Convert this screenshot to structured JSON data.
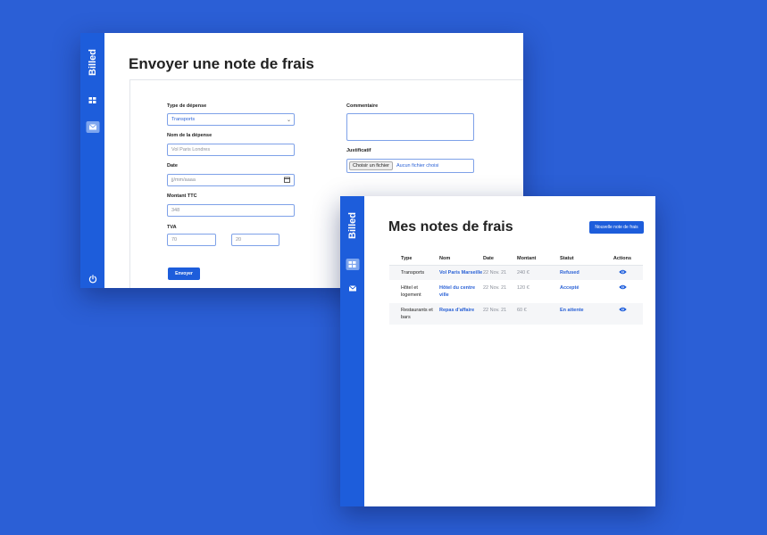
{
  "brand": "Billed",
  "colors": {
    "background": "#2b5fd6",
    "accent": "#1d5ddb",
    "link": "#2b62d6"
  },
  "form_window": {
    "title": "Envoyer une note de frais",
    "fields": {
      "type_label": "Type de dépense",
      "type_value": "Transports",
      "nom_label": "Nom de la dépense",
      "nom_placeholder": "Vol Paris Londres",
      "date_label": "Date",
      "date_placeholder": "jj/mm/aaaa",
      "montant_label": "Montant TTC",
      "montant_placeholder": "348",
      "tva_label": "TVA",
      "tva_amount_placeholder": "70",
      "tva_pct_placeholder": "20",
      "commentaire_label": "Commentaire",
      "justificatif_label": "Justificatif",
      "file_button": "Choisir un fichier",
      "file_status": "Aucun fichier choisi"
    },
    "submit_label": "Envoyer",
    "icons": [
      "window-icon",
      "mail-icon",
      "power-icon"
    ]
  },
  "list_window": {
    "title": "Mes notes de frais",
    "new_button": "Nouvelle note de frais",
    "columns": [
      "Type",
      "Nom",
      "Date",
      "Montant",
      "Statut",
      "Actions"
    ],
    "rows": [
      {
        "type": "Transports",
        "nom": "Vol Paris Marseille",
        "date": "22 Nov. 21",
        "montant": "240 €",
        "statut": "Refused"
      },
      {
        "type": "Hôtel et logement",
        "nom": "Hôtel du centre ville",
        "date": "22 Nov. 21",
        "montant": "120 €",
        "statut": "Accepté"
      },
      {
        "type": "Restaurants et bars",
        "nom": "Repas d'affaire",
        "date": "22 Nov. 21",
        "montant": "60 €",
        "statut": "En attente"
      }
    ],
    "icons": [
      "window-icon",
      "mail-icon",
      "eye-icon"
    ]
  }
}
